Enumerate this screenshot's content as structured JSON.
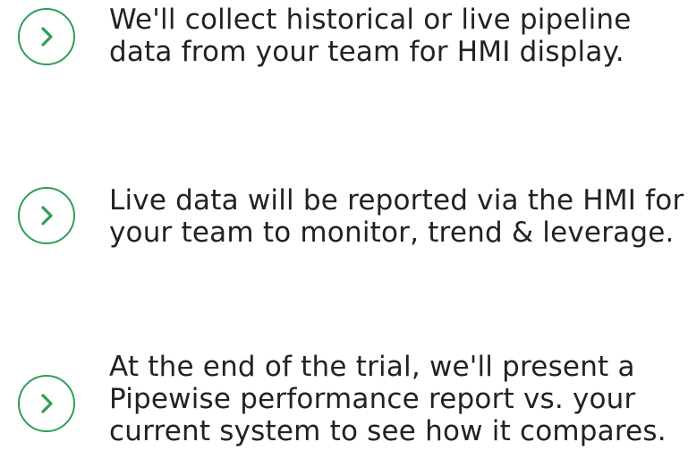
{
  "colors": {
    "accent": "#2e9e57",
    "text": "#222222",
    "background": "#ffffff"
  },
  "steps": [
    {
      "icon": "chevron-right-icon",
      "lines": [
        "We'll collect historical or live pipeline",
        "data from your team for HMI display."
      ]
    },
    {
      "icon": "chevron-right-icon",
      "lines": [
        "Live data will be reported via the HMI for",
        "your team to monitor, trend & leverage."
      ]
    },
    {
      "icon": "chevron-right-icon",
      "lines": [
        "At the end of the trial, we'll present a",
        "Pipewise performance report vs. your",
        "current system to see how it compares."
      ]
    }
  ]
}
